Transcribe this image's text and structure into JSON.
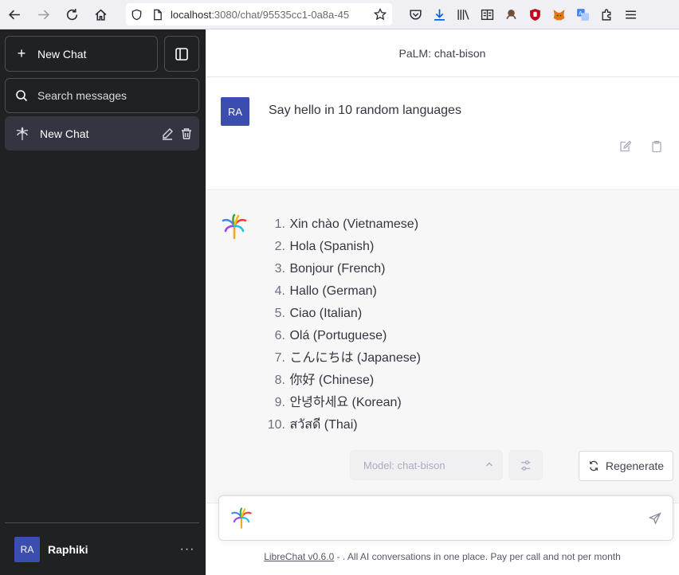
{
  "browser": {
    "url_host": "localhost",
    "url_path": ":3080/chat/95535cc1-0a8a-45"
  },
  "sidebar": {
    "new_chat_label": "New Chat",
    "search_placeholder": "Search messages",
    "conversations": [
      {
        "title": "New Chat"
      }
    ],
    "user": {
      "initials": "RA",
      "name": "Raphiki",
      "more": "···"
    }
  },
  "main": {
    "model_title": "PaLM: chat-bison",
    "user_message": {
      "initials": "RA",
      "text": "Say hello in 10 random languages"
    },
    "bot_answer": [
      {
        "num": "1.",
        "text": "Xin chào (Vietnamese)"
      },
      {
        "num": "2.",
        "text": "Hola (Spanish)"
      },
      {
        "num": "3.",
        "text": "Bonjour (French)"
      },
      {
        "num": "4.",
        "text": "Hallo (German)"
      },
      {
        "num": "5.",
        "text": "Ciao (Italian)"
      },
      {
        "num": "6.",
        "text": "Olá (Portuguese)"
      },
      {
        "num": "7.",
        "text": "こんにちは (Japanese)"
      },
      {
        "num": "8.",
        "text": "你好 (Chinese)"
      },
      {
        "num": "9.",
        "text": "안녕하세요 (Korean)"
      },
      {
        "num": "10.",
        "text": "สวัสดี (Thai)"
      }
    ],
    "controls": {
      "model_select": "Model: chat-bison",
      "regenerate_label": "Regenerate"
    },
    "input": {
      "placeholder": ""
    },
    "footer": {
      "link": "LibreChat v0.6.0",
      "text": " - . All AI conversations in one place. Pay per call and not per month"
    }
  },
  "colors": {
    "sidebar_bg": "#202123",
    "active_convo_bg": "#343541",
    "avatar_bg": "#3c4db0",
    "bot_msg_bg": "#f7f7f8"
  }
}
